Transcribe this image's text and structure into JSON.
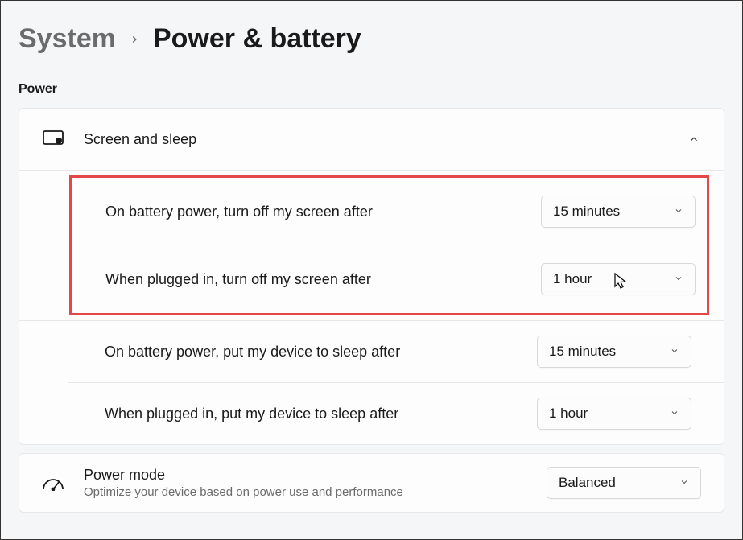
{
  "breadcrumb": {
    "parent": "System",
    "current": "Power & battery"
  },
  "section": {
    "label": "Power"
  },
  "screen_sleep": {
    "title": "Screen and sleep",
    "rows": [
      {
        "label": "On battery power, turn off my screen after",
        "value": "15 minutes"
      },
      {
        "label": "When plugged in, turn off my screen after",
        "value": "1 hour"
      },
      {
        "label": "On battery power, put my device to sleep after",
        "value": "15 minutes"
      },
      {
        "label": "When plugged in, put my device to sleep after",
        "value": "1 hour"
      }
    ]
  },
  "power_mode": {
    "title": "Power mode",
    "subtitle": "Optimize your device based on power use and performance",
    "value": "Balanced"
  }
}
